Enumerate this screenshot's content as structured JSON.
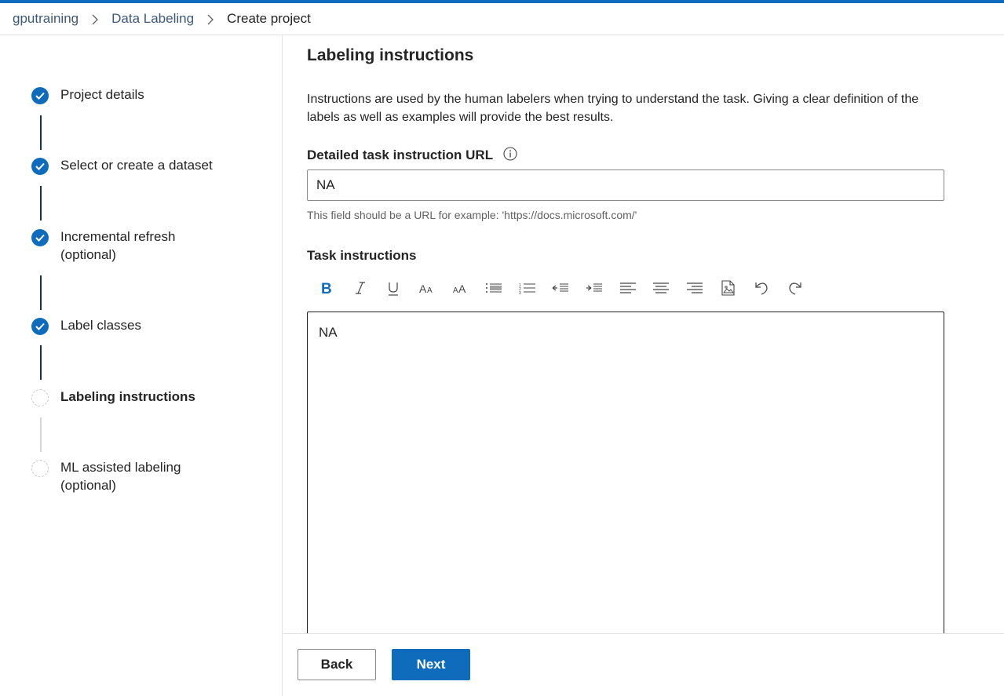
{
  "breadcrumb": {
    "items": [
      "gputraining",
      "Data Labeling"
    ],
    "current": "Create project"
  },
  "steps": [
    {
      "label_line1": "Project details",
      "label_line2": "",
      "status": "done"
    },
    {
      "label_line1": "Select or create a dataset",
      "label_line2": "",
      "status": "done"
    },
    {
      "label_line1": "Incremental refresh",
      "label_line2": "(optional)",
      "status": "done"
    },
    {
      "label_line1": "Label classes",
      "label_line2": "",
      "status": "done"
    },
    {
      "label_line1": "Labeling instructions",
      "label_line2": "",
      "status": "active"
    },
    {
      "label_line1": "ML assisted labeling",
      "label_line2": "(optional)",
      "status": "pending"
    }
  ],
  "main": {
    "title": "Labeling instructions",
    "description": "Instructions are used by the human labelers when trying to understand the task. Giving a clear definition of the labels as well as examples will provide the best results.",
    "url_field": {
      "label": "Detailed task instruction URL",
      "value": "NA",
      "hint": "This field should be a URL for example: 'https://docs.microsoft.com/'"
    },
    "task": {
      "label": "Task instructions",
      "content": "NA"
    },
    "toolbar_icons": [
      "bold-icon",
      "italic-icon",
      "underline-icon",
      "decrease-font-icon",
      "increase-font-icon",
      "bulleted-list-icon",
      "numbered-list-icon",
      "decrease-indent-icon",
      "increase-indent-icon",
      "align-left-icon",
      "align-center-icon",
      "align-right-icon",
      "insert-image-icon",
      "undo-icon",
      "redo-icon"
    ]
  },
  "footer": {
    "back_label": "Back",
    "next_label": "Next"
  },
  "colors": {
    "accent": "#0f6cbd",
    "completed_connector": "#123456",
    "pending_connector": "#d6d6d6"
  }
}
